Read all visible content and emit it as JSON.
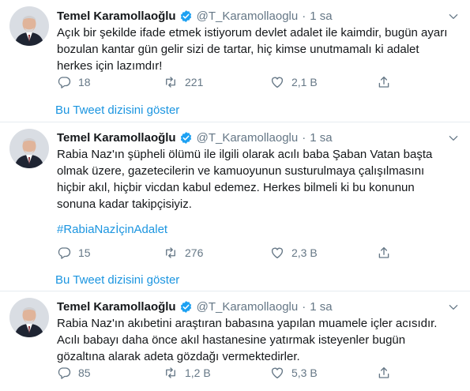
{
  "colors": {
    "link": "#1b95e0",
    "muted": "#657786",
    "verified": "#1da1f2",
    "divider": "#e6ecf0"
  },
  "tweets": [
    {
      "name": "Temel Karamollaoğlu",
      "handle": "@T_Karamollaoglu",
      "separator": "·",
      "time": "1 sa",
      "text_lines": [
        "Açık bir şekilde ifade etmek istiyorum devlet adalet ile kaimdir, bugün ayarı",
        "bozulan kantar gün gelir sizi de tartar, hiç kimse unutmamalı ki adalet",
        "herkes için lazımdır!"
      ],
      "hashtag": "",
      "replies": "18",
      "retweets": "221",
      "likes": "2,1 B",
      "thread_link": "Bu Tweet dizisini göster"
    },
    {
      "name": "Temel Karamollaoğlu",
      "handle": "@T_Karamollaoglu",
      "separator": "·",
      "time": "1 sa",
      "text_lines": [
        "Rabia Naz'ın şüpheli ölümü ile ilgili olarak acılı baba Şaban Vatan başta",
        "olmak üzere, gazetecilerin ve kamuoyunun susturulmaya çalışılmasını",
        "hiçbir akıl, hiçbir vicdan kabul edemez. Herkes bilmeli ki bu konunun",
        "sonuna kadar takipçisiyiz."
      ],
      "hashtag": "#RabiaNazİçinAdalet",
      "replies": "15",
      "retweets": "276",
      "likes": "2,3 B",
      "thread_link": "Bu Tweet dizisini göster"
    },
    {
      "name": "Temel Karamollaoğlu",
      "handle": "@T_Karamollaoglu",
      "separator": "·",
      "time": "1 sa",
      "text_lines": [
        "Rabia Naz'ın akıbetini araştıran babasına yapılan muamele içler acısıdır.",
        "Acılı babayı daha önce akıl hastanesine yatırmak isteyenler bugün",
        "gözaltına alarak adeta gözdağı vermektedirler."
      ],
      "hashtag": "",
      "replies": "85",
      "retweets": "1,2 B",
      "likes": "5,3 B",
      "thread_link": ""
    }
  ],
  "icons": [
    "caret-down-icon",
    "verified-badge-icon",
    "reply-icon",
    "retweet-icon",
    "like-icon",
    "share-icon"
  ]
}
